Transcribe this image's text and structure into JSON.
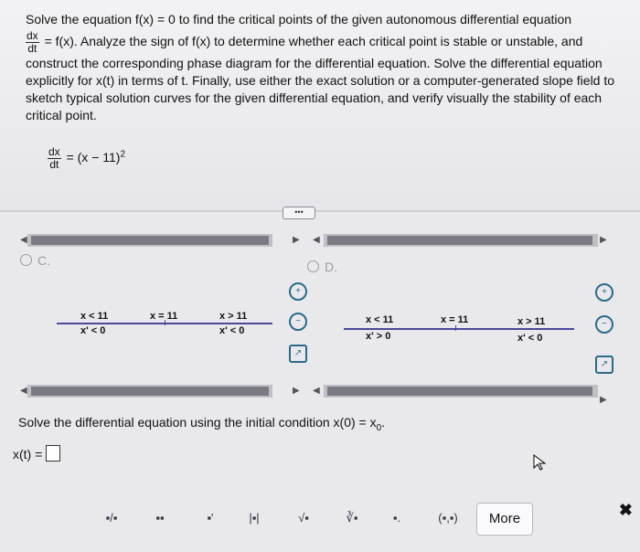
{
  "question": {
    "line1": "Solve the equation f(x) = 0 to find the critical points of the given autonomous differential equation",
    "frac_num": "dx",
    "frac_den": "dt",
    "line2": "= f(x). Analyze the sign of f(x) to determine whether each critical point is stable or unstable, and",
    "line3": "construct the corresponding phase diagram for the differential equation. Solve the differential equation",
    "line4": "explicitly for x(t) in terms of t. Finally, use either the exact solution or a computer-generated slope field to",
    "line5": "sketch typical solution curves for the given differential equation, and verify visually the stability of each",
    "line6": "critical point."
  },
  "equation": {
    "num": "dx",
    "den": "dt",
    "rhs": "= (x − 11)",
    "exp": "2"
  },
  "options": {
    "c": {
      "label": "C.",
      "left_top": "x < 11",
      "left_bot": "x' < 0",
      "mid": "x = 11",
      "right_top": "x > 11",
      "right_bot": "x' < 0"
    },
    "d": {
      "label": "D.",
      "left_top": "x < 11",
      "left_bot": "x' > 0",
      "mid": "x = 11",
      "right_top": "x > 11",
      "right_bot": "x' < 0"
    }
  },
  "more_dots": "•••",
  "solve": {
    "text": "Solve the differential equation using the initial condition x(0) = x",
    "sub": "0",
    "end": "."
  },
  "answer": {
    "label": "x(t) ="
  },
  "toolbar": {
    "items": [
      "▪/▪",
      "▪▪",
      "▪'",
      "|▪|",
      "√▪",
      "∛▪",
      "▪.",
      "(▪,▪)"
    ],
    "more": "More",
    "close": "✖"
  },
  "colors": {
    "accent": "#2a6a8a",
    "line": "#4a4a9a"
  }
}
